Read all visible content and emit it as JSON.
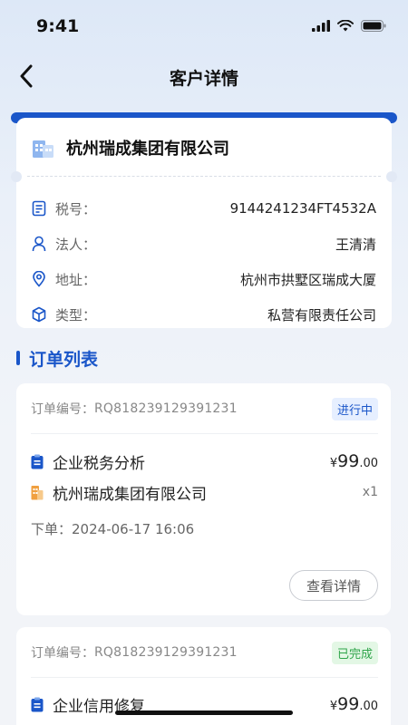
{
  "status_bar": {
    "time": "9:41"
  },
  "header": {
    "title": "客户详情"
  },
  "company": {
    "name": "杭州瑞成集团有限公司",
    "fields": [
      {
        "icon": "tax-id-icon",
        "label": "税号：",
        "value": "9144241234FT4532A"
      },
      {
        "icon": "person-icon",
        "label": "法人：",
        "value": "王清清"
      },
      {
        "icon": "location-pin-icon",
        "label": "地址：",
        "value": "杭州市拱墅区瑞成大厦"
      },
      {
        "icon": "cube-icon",
        "label": "类型：",
        "value": "私营有限责任公司"
      }
    ]
  },
  "orders_section": {
    "title": "订单列表"
  },
  "orders": [
    {
      "no_label": "订单编号：",
      "no": "RQ818239129391231",
      "status": "进行中",
      "status_color": "#1a56c9",
      "service": "企业税务分析",
      "currency": "¥",
      "price_int": "99",
      "price_dec": ".00",
      "company": "杭州瑞成集团有限公司",
      "qty": "x1",
      "time_label": "下单：",
      "time": "2024-06-17 16:06",
      "detail_button": "查看详情"
    },
    {
      "no_label": "订单编号：",
      "no": "RQ818239129391231",
      "status": "已完成",
      "status_color": "#2fa44a",
      "service": "企业信用修复",
      "currency": "¥",
      "price_int": "99",
      "price_dec": ".00"
    }
  ],
  "colors": {
    "primary": "#1a56c9",
    "success": "#2fa44a",
    "icon_orange": "#f0a040"
  }
}
